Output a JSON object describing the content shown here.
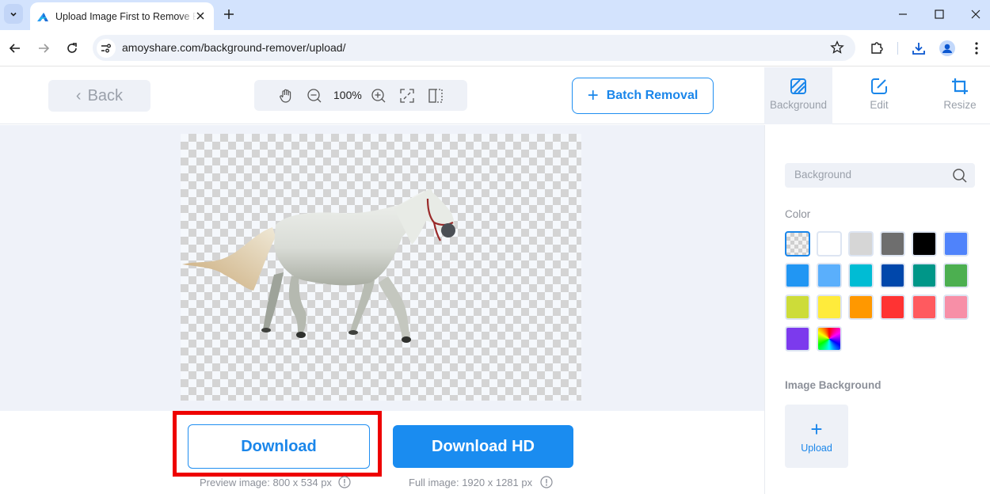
{
  "browser": {
    "tab_title": "Upload Image First to Remove Background",
    "url": "amoyshare.com/background-remover/upload/"
  },
  "header": {
    "back_label": "Back",
    "zoom_level": "100%",
    "batch_label": "Batch Removal",
    "side_tabs": [
      {
        "label": "Background",
        "icon": "background-icon",
        "active": true
      },
      {
        "label": "Edit",
        "icon": "edit-icon",
        "active": false
      },
      {
        "label": "Resize",
        "icon": "crop-icon",
        "active": false
      }
    ]
  },
  "main": {
    "image_subject": "white horse with transparent background",
    "download_label": "Download",
    "download_hd_label": "Download HD",
    "preview_note": "Preview image: 800 x 534 px",
    "full_note": "Full image: 1920 x 1281 px"
  },
  "panel": {
    "search_placeholder": "Background",
    "color_label": "Color",
    "colors": [
      {
        "name": "transparent",
        "hex": "transparent",
        "selected": true
      },
      {
        "name": "white",
        "hex": "#ffffff"
      },
      {
        "name": "light-gray",
        "hex": "#d6d6d6"
      },
      {
        "name": "gray",
        "hex": "#6e6e6e"
      },
      {
        "name": "black",
        "hex": "#000000"
      },
      {
        "name": "blue",
        "hex": "#4f83fb"
      },
      {
        "name": "sky-blue",
        "hex": "#2196f3"
      },
      {
        "name": "light-blue",
        "hex": "#5aaffc"
      },
      {
        "name": "cyan",
        "hex": "#00bcd4"
      },
      {
        "name": "navy",
        "hex": "#0047ab"
      },
      {
        "name": "teal",
        "hex": "#009688"
      },
      {
        "name": "green",
        "hex": "#4caf50"
      },
      {
        "name": "lime",
        "hex": "#cddc39"
      },
      {
        "name": "yellow",
        "hex": "#ffeb3b"
      },
      {
        "name": "orange",
        "hex": "#ff9800"
      },
      {
        "name": "red",
        "hex": "#ff3333"
      },
      {
        "name": "coral",
        "hex": "#ff5a5f"
      },
      {
        "name": "pink",
        "hex": "#f78fa7"
      },
      {
        "name": "purple",
        "hex": "#7c3aed"
      },
      {
        "name": "custom",
        "hex": "rainbow"
      }
    ],
    "image_bg_label": "Image Background",
    "upload_label": "Upload"
  },
  "colors": {
    "accent": "#1a86ea",
    "highlight": "#ee0000"
  }
}
